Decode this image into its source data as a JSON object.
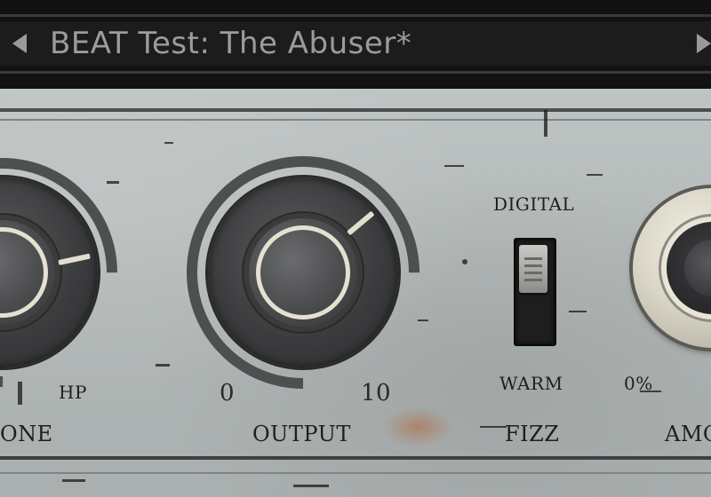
{
  "preset": {
    "name": "BEAT Test: The Abuser*",
    "prev_icon": "triangle-left",
    "next_icon": "triangle-right"
  },
  "controls": {
    "tone": {
      "label": "ONE",
      "scale_right": "HP"
    },
    "output": {
      "label": "OUTPUT",
      "scale_min": "0",
      "scale_max": "10"
    },
    "fizz": {
      "label": "FIZZ",
      "top_label": "DIGITAL",
      "bottom_label": "WARM"
    },
    "amount": {
      "label": "AMO",
      "scale_min": "0%"
    }
  },
  "colors": {
    "panel": "#b3b9b8",
    "knob_ring": "#e4e1d2",
    "preset_text": "#9c9c9c",
    "header_bg": "#121212"
  }
}
